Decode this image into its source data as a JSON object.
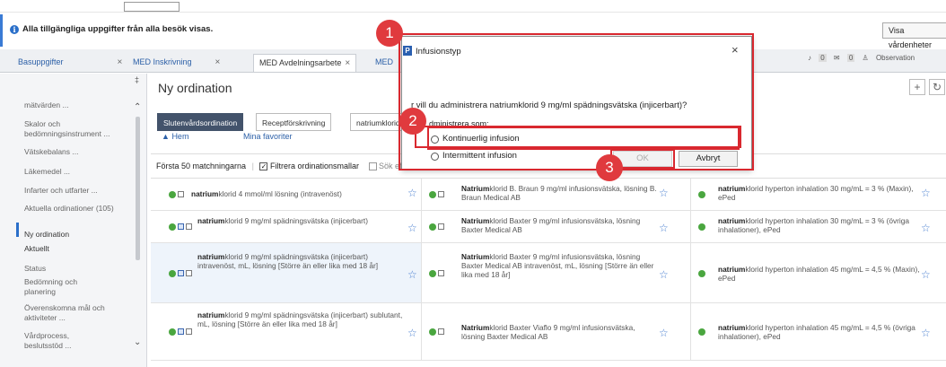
{
  "info_bar": {
    "message": "Alla tillgängliga uppgifter från alla besök visas.",
    "button": "Visa vårdenheter"
  },
  "tabs": [
    {
      "label": "Basuppgifter",
      "close": "×"
    },
    {
      "label": "MED Inskrivning",
      "close": "×"
    },
    {
      "label": "MED Avdelningsarbete",
      "close": "×"
    },
    {
      "label": "MED"
    }
  ],
  "toolbar_right": {
    "count1": "0",
    "count2": "0",
    "observation": "Observation"
  },
  "sidebar": {
    "items": [
      "mätvärden ...",
      "Skalor och bedömningsinstrument ...",
      "Vätskebalans ...",
      "Läkemedel ...",
      "Infarter och utfarter ...",
      "Aktuella ordinationer (105)",
      "Ny ordination",
      "Aktuellt",
      "Status",
      "Bedömning och planering",
      "Överenskomna mål och aktiviteter ...",
      "Vårdprocess, beslutsstöd ..."
    ]
  },
  "main": {
    "title": "Ny ordination",
    "plus": "+",
    "subtabs": [
      "Slutenvårdsordination",
      "Receptförskrivning",
      "natriumklorid"
    ],
    "home": "Hem",
    "favorites": "Mina favoriter",
    "matches": "Första 50 matchningarna",
    "filter_label": "Filtrera ordinationsmallar",
    "search_more": "Sök efter ytterligare objekt"
  },
  "grid": [
    [
      {
        "b": "natrium",
        "t": "klorid 4 mmol/ml lösning (intravenöst)"
      },
      {
        "b": "Natrium",
        "t": "klorid B. Braun 9 mg/ml infusionsvätska, lösning B. Braun Medical AB"
      },
      {
        "b": "natrium",
        "t": "klorid hyperton inhalation 30 mg/mL = 3 % (Maxin), ePed"
      }
    ],
    [
      {
        "b": "natrium",
        "t": "klorid 9 mg/ml spädningsvätska (injicerbart)"
      },
      {
        "b": "Natrium",
        "t": "klorid Baxter 9 mg/ml infusionsvätska, lösning Baxter Medical AB"
      },
      {
        "b": "natrium",
        "t": "klorid hyperton inhalation 30 mg/mL = 3 % (övriga inhalationer), ePed"
      }
    ],
    [
      {
        "b": "natrium",
        "t": "klorid 9 mg/ml spädningsvätska (injicerbart) intravenöst, mL, lösning [Större än eller lika med 18 år]"
      },
      {
        "b": "Natrium",
        "t": "klorid Baxter 9 mg/ml infusionsvätska, lösning Baxter Medical AB intravenöst, mL, lösning [Större än eller lika med 18 år]"
      },
      {
        "b": "natrium",
        "t": "klorid hyperton inhalation 45 mg/mL = 4,5 % (Maxin), ePed"
      }
    ],
    [
      {
        "b": "natrium",
        "t": "klorid 9 mg/ml spädningsvätska (injicerbart) sublutant, mL, lösning [Större än eller lika med 18 år]"
      },
      {
        "b": "Natrium",
        "t": "klorid Baxter Viaflo 9 mg/ml infusionsvätska, lösning Baxter Medical AB"
      },
      {
        "b": "natrium",
        "t": "klorid hyperton inhalation 45 mg/mL = 4,5 % (övriga inhalationer), ePed"
      }
    ]
  ],
  "dialog": {
    "icon": "P",
    "title": "Infusionstyp",
    "close": "×",
    "question": "r vill du administrera natriumklorid 9 mg/ml spädningsvätska (injicerbart)?",
    "administer_as": "dministrera som:",
    "option1": "Kontinuerlig infusion",
    "option2": "Intermittent infusion",
    "ok": "OK",
    "cancel": "Avbryt"
  },
  "badges": [
    "1",
    "2",
    "3"
  ],
  "colors": {
    "accent": "#2a6fc9",
    "highlight": "#d9282f",
    "status_green": "#4aa63f"
  }
}
